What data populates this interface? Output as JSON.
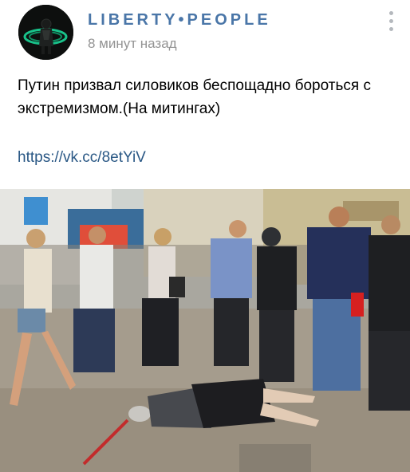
{
  "post": {
    "group_name": "LIBERTY•PEOPLE",
    "time": "8 минут назад",
    "text": "Путин призвал силовиков беспощадно бороться с экстремизмом.(На митингах)",
    "link": "https://vk.cc/8etYiV"
  },
  "icons": {
    "avatar": "group-avatar-icon",
    "more": "more-vertical-icon"
  },
  "colors": {
    "accent": "#4a76a8",
    "link": "#2a5885",
    "muted": "#939393"
  }
}
